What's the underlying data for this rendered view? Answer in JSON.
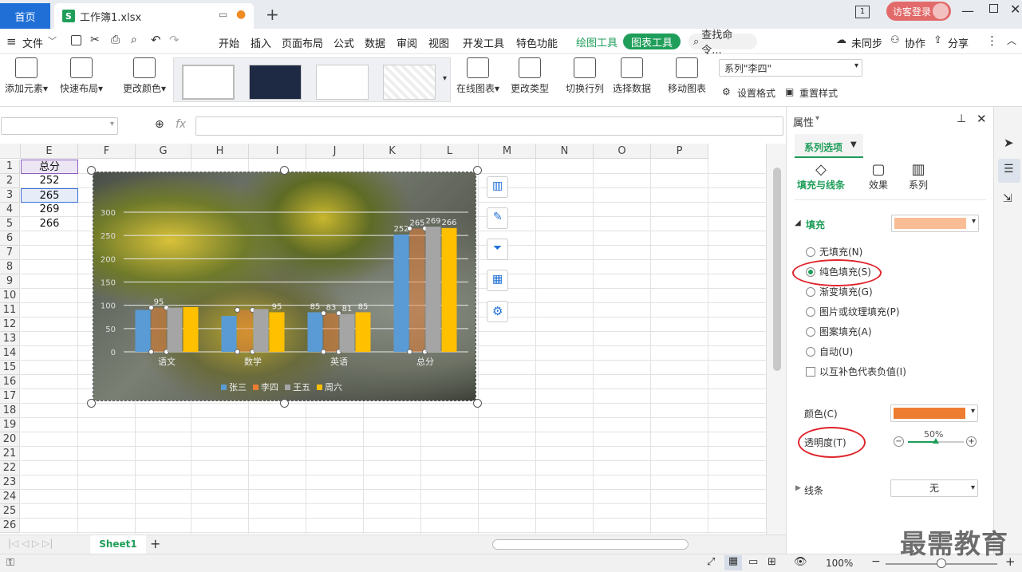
{
  "tabs": {
    "home": "首页",
    "doc": "工作簿1.xlsx"
  },
  "account": {
    "login": "访客登录"
  },
  "menu": {
    "file": "文件",
    "items": [
      "开始",
      "插入",
      "页面布局",
      "公式",
      "数据",
      "审阅",
      "视图",
      "开发工具",
      "特色功能"
    ],
    "draw_tools": "绘图工具",
    "chart_tools": "图表工具",
    "search": "查找命令...",
    "sync": "未同步",
    "collab": "协作",
    "share": "分享"
  },
  "ribbon": {
    "add_element": "添加元素",
    "quick_layout": "快速布局",
    "change_color": "更改颜色",
    "online_chart": "在线图表",
    "change_type": "更改类型",
    "switch_rowcol": "切换行列",
    "select_data": "选择数据",
    "move_chart": "移动图表",
    "series_select": "系列\"李四\"",
    "set_format": "设置格式",
    "reset_style": "重置样式"
  },
  "formula": {
    "fx": "fx"
  },
  "columns": [
    "E",
    "F",
    "G",
    "H",
    "I",
    "J",
    "K",
    "L",
    "M",
    "N",
    "O",
    "P"
  ],
  "rows": [
    "1",
    "2",
    "3",
    "4",
    "5",
    "6",
    "7",
    "8",
    "9",
    "10",
    "11",
    "12",
    "13",
    "14",
    "15",
    "16",
    "17",
    "18",
    "19",
    "20",
    "21",
    "22",
    "23",
    "24",
    "25",
    "26"
  ],
  "cells_e": [
    "总分",
    "252",
    "265",
    "269",
    "266"
  ],
  "chart_data": {
    "type": "bar",
    "categories": [
      "语文",
      "数学",
      "英语",
      "总分"
    ],
    "series": [
      {
        "name": "张三",
        "values": [
          90,
          77,
          85,
          252
        ],
        "color": "#5b9bd5"
      },
      {
        "name": "李四",
        "values": [
          95,
          90,
          83,
          265
        ],
        "color": "#ed7d31"
      },
      {
        "name": "王五",
        "values": [
          95,
          92,
          81,
          269
        ],
        "color": "#a5a5a5"
      },
      {
        "name": "周六",
        "values": [
          96,
          85,
          85,
          266
        ],
        "color": "#ffc000"
      }
    ],
    "data_labels": [
      "",
      "95",
      "",
      "",
      "",
      "",
      "",
      "95",
      "85",
      "83",
      "81",
      "85",
      "252",
      "265",
      "269",
      "266"
    ],
    "y_ticks": [
      "0",
      "50",
      "100",
      "150",
      "200",
      "250",
      "300"
    ],
    "ylim": [
      0,
      300
    ],
    "legend": "bottom",
    "grid": true
  },
  "panel": {
    "title": "属性",
    "tab": "系列选项",
    "subtabs": [
      "填充与线条",
      "效果",
      "系列"
    ],
    "fill_section": "填充",
    "fill_color": "#f9bd96",
    "options": [
      "无填充(N)",
      "纯色填充(S)",
      "渐变填充(G)",
      "图片或纹理填充(P)",
      "图案填充(A)",
      "自动(U)"
    ],
    "invert": "以互补色代表负值(I)",
    "color_label": "颜色(C)",
    "color_value": "#ed7d31",
    "transparency_label": "透明度(T)",
    "transparency_value": "50%",
    "transparency_level": 0.5,
    "line_label": "线条",
    "line_value": "无"
  },
  "sheet": {
    "name": "Sheet1",
    "add": "+"
  },
  "status": {
    "zoom": "100%"
  },
  "watermark": "最需教育"
}
